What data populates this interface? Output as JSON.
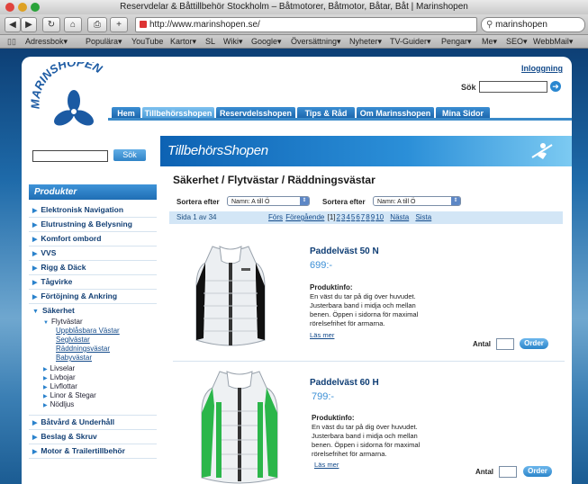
{
  "window": {
    "title": "Reservdelar & Båttillbehör Stockholm – Båtmotorer, Båtmotor, Båtar, Båt | Marinshopen"
  },
  "toolbar": {
    "back": "◀",
    "forward": "▶",
    "reload": "↻",
    "home": "⌂",
    "print": "⎙",
    "add": "+",
    "url": "http://www.marinshopen.se/",
    "search_value": "marinshopen"
  },
  "bookmarks": [
    "Adressbok▾",
    "Populära▾",
    "YouTube",
    "Kartor▾",
    "SL",
    "Wiki▾",
    "Google▾",
    "Översättning▾",
    "Nyheter▾",
    "TV-Guider▾",
    "Pengar▾",
    "Me▾",
    "SEO▾",
    "WebbMail▾"
  ],
  "header": {
    "logo_text": "MARINSHOPEN",
    "login": "Inloggning",
    "search_label": "Sök"
  },
  "nav": [
    "Hem",
    "Tillbehörsshopen",
    "Reservdelsshopen",
    "Tips & Råd",
    "Om Marinsshopen",
    "Mina Sidor"
  ],
  "left": {
    "search_button": "Sök",
    "products_heading": "Produkter",
    "categories": [
      "Elektronisk Navigation",
      "Elutrustning & Belysning",
      "Komfort ombord",
      "VVS",
      "Rigg & Däck",
      "Tågvirke",
      "Förtöjning & Ankring",
      "Säkerhet"
    ],
    "safety_sub": "Flytvästar",
    "flytvastar_items": [
      "Uppblåsbara Västar",
      "Seglvästar",
      "Räddningsvästar",
      "Babyvästar"
    ],
    "safety_more": [
      "Livselar",
      "Livbojar",
      "Livflottar",
      "Linor & Stegar",
      "Nödljus"
    ],
    "bottom_categories": [
      "Båtvård & Underhåll",
      "Beslag & Skruv",
      "Motor & Trailertillbehör"
    ]
  },
  "main": {
    "banner": "TillbehörsShopen",
    "heading": "Säkerhet / Flytvästar / Räddningsvästar",
    "sort_label": "Sortera efter",
    "sort_value": "Namn: A till Ö",
    "page_info": "Sida 1 av 34",
    "pager_first": "Förs",
    "pager_prev": "Föregående",
    "pager_current": "[1]",
    "pager_numbers": [
      "2",
      "3",
      "4",
      "5",
      "6",
      "7",
      "8",
      "9",
      "10"
    ],
    "pager_next": "Nästa",
    "pager_last": "Sista"
  },
  "products": [
    {
      "name": "Paddelväst 50 N",
      "price": "699:-",
      "info_label": "Produktinfo:",
      "desc": "En väst du tar på dig över huvudet. Justerbara band i midja och mellan benen. Öppen i sidorna för maximal rörelsefrihet för armarna.",
      "more": "Läs mer",
      "qty_label": "Antal",
      "order": "Order",
      "accent": "#111111"
    },
    {
      "name": "Paddelväst 60 H",
      "price": "799:-",
      "info_label": "Produktinfo:",
      "desc": "En väst du tar på dig över huvudet. Justerbara band i midja och mellan benen. Öppen i sidorna för maximal rörelsefrihet för armarna.",
      "more": "Läs mer",
      "qty_label": "Antal",
      "order": "Order",
      "accent": "#2bb64a"
    }
  ],
  "colors": {
    "brand": "#1a6bb3",
    "nav_active": "#6ab6ec",
    "link": "#134a8a"
  }
}
